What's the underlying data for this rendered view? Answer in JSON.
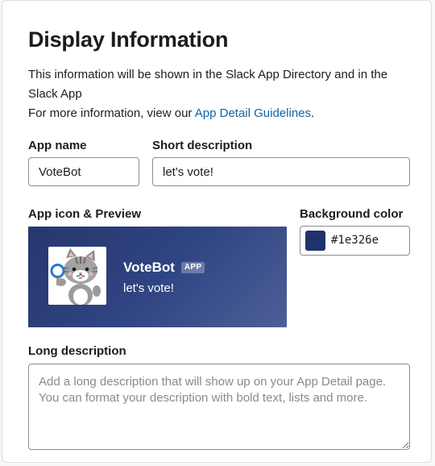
{
  "section": {
    "title": "Display Information",
    "intro_line1": "This information will be shown in the Slack App Directory and in the Slack App",
    "intro_line2_prefix": "For more information, view our ",
    "intro_link": "App Detail Guidelines",
    "intro_line2_suffix": "."
  },
  "app_name": {
    "label": "App name",
    "value": "VoteBot"
  },
  "short_description": {
    "label": "Short description",
    "value": "let's vote!"
  },
  "preview": {
    "label": "App icon & Preview",
    "name": "VoteBot",
    "badge": "APP",
    "description": "let's vote!",
    "icon": "cat-holding-sign-icon"
  },
  "background_color": {
    "label": "Background color",
    "value": "#1e326e",
    "swatch": "#1e326e"
  },
  "long_description": {
    "label": "Long description",
    "placeholder": "Add a long description that will show up on your App Detail page. You can format your description with bold text, lists and more."
  }
}
